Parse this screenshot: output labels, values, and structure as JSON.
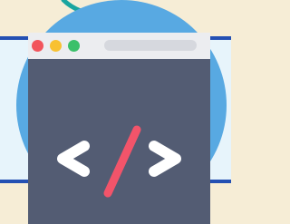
{
  "illustration": {
    "subject": "browser-window-code-icon",
    "colors": {
      "background": "#f6edd6",
      "band": "#e7f4fb",
      "band_border": "#2450b3",
      "circle": "#58a9e2",
      "window_body": "#535c73",
      "titlebar": "#ecedf0",
      "address_bar": "#d6d8de",
      "dot_red": "#f2545b",
      "dot_yellow": "#f8c131",
      "dot_green": "#3bc06a",
      "brackets": "#ffffff",
      "slash": "#f2546a",
      "swirl": "#1aa5a0"
    },
    "icons": {
      "main": "code-brackets-icon",
      "window_controls": [
        "close-dot",
        "minimize-dot",
        "maximize-dot"
      ]
    }
  }
}
